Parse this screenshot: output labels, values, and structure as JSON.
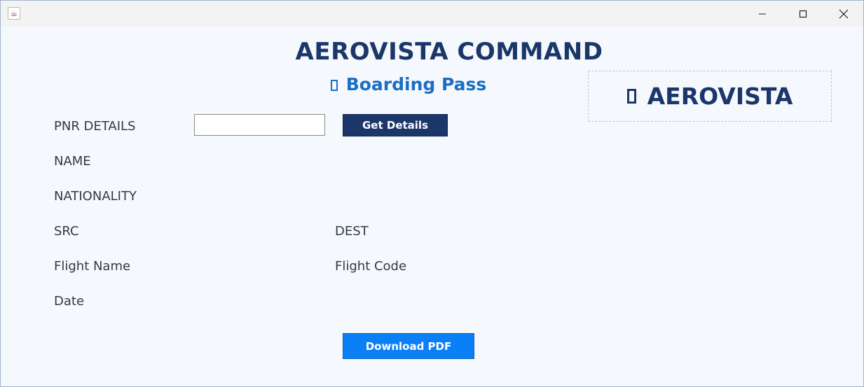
{
  "window": {
    "icon": "java-cup-icon",
    "controls": {
      "minimize": "minimize-icon",
      "maximize": "maximize-icon",
      "close": "close-icon"
    }
  },
  "header": {
    "title": "AEROVISTA COMMAND",
    "subtitle": "Boarding Pass"
  },
  "logo": {
    "text": "AEROVISTA"
  },
  "form": {
    "pnr_label": "PNR DETAILS",
    "pnr_value": "",
    "get_details_label": "Get Details",
    "name_label": "NAME",
    "nationality_label": "NATIONALITY",
    "src_label": "SRC",
    "dest_label": "DEST",
    "flight_name_label": "Flight Name",
    "flight_code_label": "Flight Code",
    "date_label": "Date",
    "download_label": "Download PDF"
  },
  "colors": {
    "title": "#1b376a",
    "subtitle": "#1a6ec4",
    "primary_button": "#1b376a",
    "download_button": "#0a7ff6",
    "background": "#f5f9fd"
  }
}
